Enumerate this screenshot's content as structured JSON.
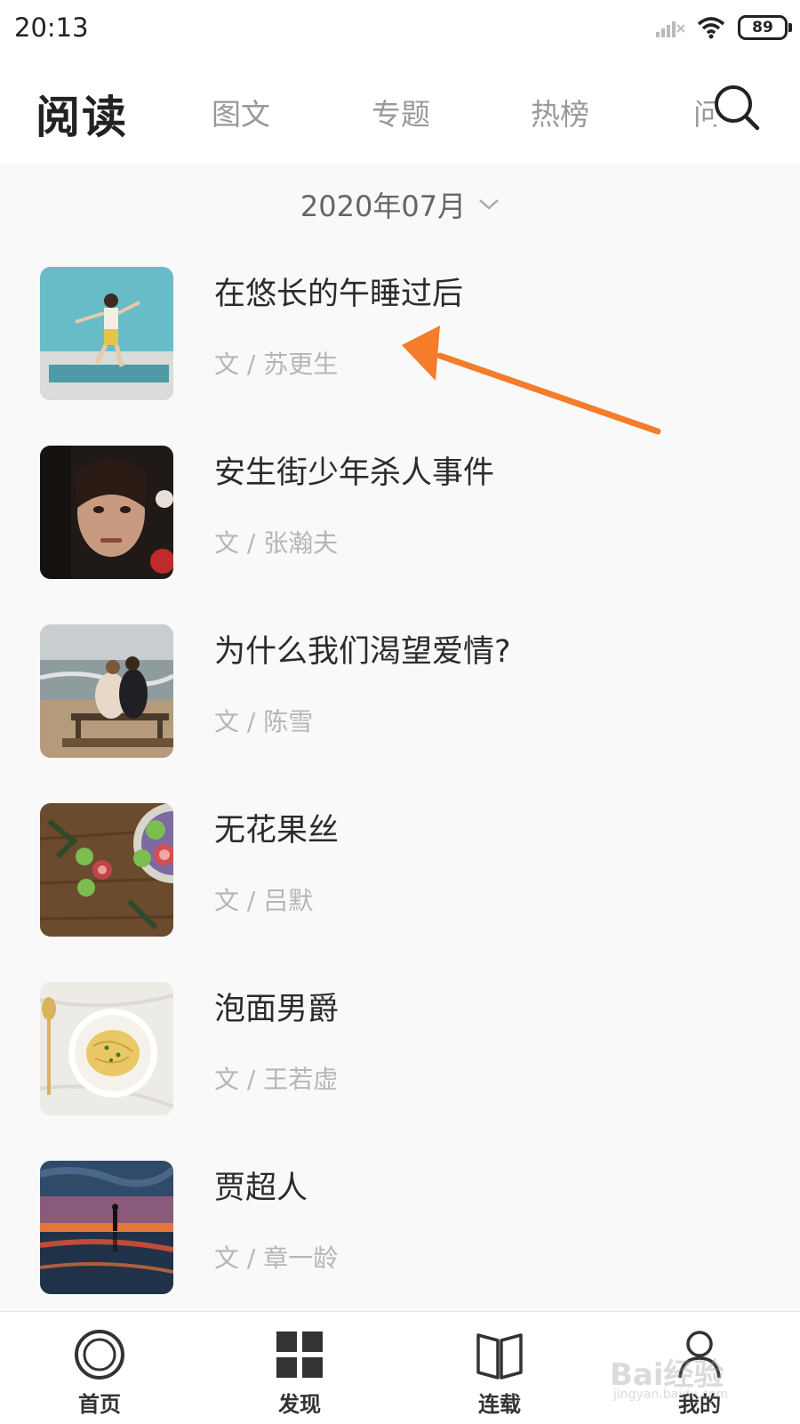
{
  "status_bar": {
    "time": "20:13",
    "battery": "89",
    "icons": [
      "signal-icon",
      "wifi-icon",
      "battery-icon"
    ]
  },
  "header": {
    "title": "阅读",
    "tabs": [
      {
        "label": "图文"
      },
      {
        "label": "专题"
      },
      {
        "label": "热榜"
      },
      {
        "label": "问"
      }
    ],
    "search_icon": "search-icon"
  },
  "month_selector": {
    "label": "2020年07月",
    "icon": "chevron-down-icon"
  },
  "articles": [
    {
      "title": "在悠长的午睡过后",
      "author": "文 / 苏更生"
    },
    {
      "title": "安生街少年杀人事件",
      "author": "文 / 张瀚夫"
    },
    {
      "title": "为什么我们渴望爱情?",
      "author": "文 / 陈雪"
    },
    {
      "title": "无花果丝",
      "author": "文 / 吕默"
    },
    {
      "title": "泡面男爵",
      "author": "文 / 王若虚"
    },
    {
      "title": "贾超人",
      "author": "文 / 章一龄"
    }
  ],
  "bottom_nav": [
    {
      "label": "首页",
      "icon": "home-ring-icon"
    },
    {
      "label": "发现",
      "icon": "grid-icon"
    },
    {
      "label": "连载",
      "icon": "book-icon"
    },
    {
      "label": "我的",
      "icon": "user-icon"
    }
  ],
  "watermark": {
    "text": "Bai经验",
    "sub": "jingyan.baidu.com"
  },
  "colors": {
    "accent_arrow": "#f47c2a",
    "text_primary": "#2b2b2b",
    "text_muted": "#b6b6b6",
    "tab_inactive": "#999999"
  }
}
